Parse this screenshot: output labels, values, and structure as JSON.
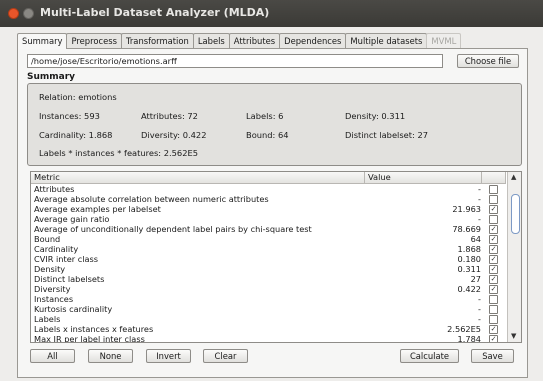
{
  "window": {
    "title": "Multi-Label Dataset Analyzer (MLDA)"
  },
  "tabs": [
    "Summary",
    "Preprocess",
    "Transformation",
    "Labels",
    "Attributes",
    "Dependences",
    "Multiple datasets",
    "MVML"
  ],
  "file": {
    "path": "/home/jose/Escritorio/emotions.arff",
    "choose_label": "Choose file"
  },
  "summary": {
    "title": "Summary",
    "relation": "Relation:  emotions",
    "instances": "Instances: 593",
    "attributes": "Attributes: 72",
    "labels": "Labels: 6",
    "density": "Density: 0.311",
    "cardinality": "Cardinality: 1.868",
    "diversity": "Diversity: 0.422",
    "bound": "Bound: 64",
    "distinct": "Distinct labelset: 27",
    "product": "Labels * instances * features: 2.562E5"
  },
  "table": {
    "headers": [
      "Metric",
      "Value"
    ],
    "rows": [
      {
        "metric": "Attributes",
        "value": "-",
        "checked": false
      },
      {
        "metric": "Average absolute correlation between numeric attributes",
        "value": "-",
        "checked": false
      },
      {
        "metric": "Average examples per labelset",
        "value": "21.963",
        "checked": true
      },
      {
        "metric": "Average gain ratio",
        "value": "-",
        "checked": false
      },
      {
        "metric": "Average of unconditionally dependent label pairs by chi-square test",
        "value": "78.669",
        "checked": true
      },
      {
        "metric": "Bound",
        "value": "64",
        "checked": true
      },
      {
        "metric": "Cardinality",
        "value": "1.868",
        "checked": true
      },
      {
        "metric": "CVIR inter class",
        "value": "0.180",
        "checked": true
      },
      {
        "metric": "Density",
        "value": "0.311",
        "checked": true
      },
      {
        "metric": "Distinct labelsets",
        "value": "27",
        "checked": true
      },
      {
        "metric": "Diversity",
        "value": "0.422",
        "checked": true
      },
      {
        "metric": "Instances",
        "value": "-",
        "checked": false
      },
      {
        "metric": "Kurtosis cardinality",
        "value": "-",
        "checked": false
      },
      {
        "metric": "Labels",
        "value": "-",
        "checked": false
      },
      {
        "metric": "Labels x instances x features",
        "value": "2.562E5",
        "checked": true
      },
      {
        "metric": "Max IR per label inter class",
        "value": "1.784",
        "checked": true
      }
    ]
  },
  "buttons": {
    "all": "All",
    "none": "None",
    "invert": "Invert",
    "clear": "Clear",
    "calculate": "Calculate",
    "save": "Save"
  }
}
